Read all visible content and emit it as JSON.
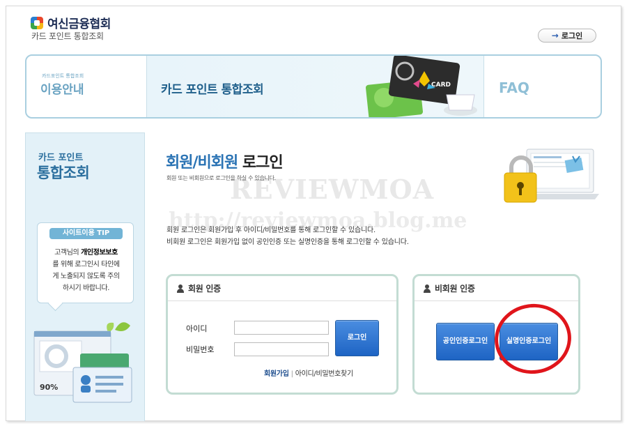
{
  "header": {
    "logo_text": "여신금융협회",
    "logo_sub": "카드 포인트 통합조회",
    "login_button": "로그인"
  },
  "nav": {
    "info_tiny": "카드포인트 통합조회",
    "info_label": "이용안내",
    "active_label": "카드 포인트 통합조회",
    "faq_label": "FAQ",
    "card_text": "CARD"
  },
  "sidebar": {
    "title_small": "카드 포인트",
    "title_big": "통합조회",
    "tip_badge": "사이트이용 TIP",
    "tip_line1_pre": "고객님의 ",
    "tip_line1_bold": "개인정보보호",
    "tip_line2": "를 위해 로그인시 타인에",
    "tip_line3": "게 노출되지 않도록 주의",
    "tip_line4": "하시기 바랍니다.",
    "illust_percent": "90%"
  },
  "main": {
    "title_blue": "회원/비회원",
    "title_dark": " 로그인",
    "subtitle": "회원 또는 비회원으로 로그인을 하실 수 있습니다.",
    "desc_line1": "회원 로그인은 회원가입 후 아이디/비밀번호를 통해 로그인할 수 있습니다.",
    "desc_line2": "비회원 로그인은 회원가입 없이 공인인증 또는 실명인증을 통해 로그인할 수 있습니다.",
    "watermark1": "REVIEWMOA",
    "watermark2": "http://reviewmoa.blog.me"
  },
  "member_panel": {
    "title": "회원 인증",
    "id_label": "아이디",
    "pw_label": "비밀번호",
    "id_value": "",
    "pw_value": "",
    "login_button": "로그인",
    "join_link": "회원가입",
    "find_link": "아이디/비밀번호찾기"
  },
  "guest_panel": {
    "title": "비회원 인증",
    "cert_button_line1": "공인인증",
    "cert_button_line2": "로그인",
    "realname_button_line1": "실명인증",
    "realname_button_line2": "로그인"
  },
  "colors": {
    "accent_blue": "#2a73b4",
    "button_blue": "#1e64c4",
    "panel_border": "#c3dcd3",
    "highlight_red": "#e0151b"
  }
}
